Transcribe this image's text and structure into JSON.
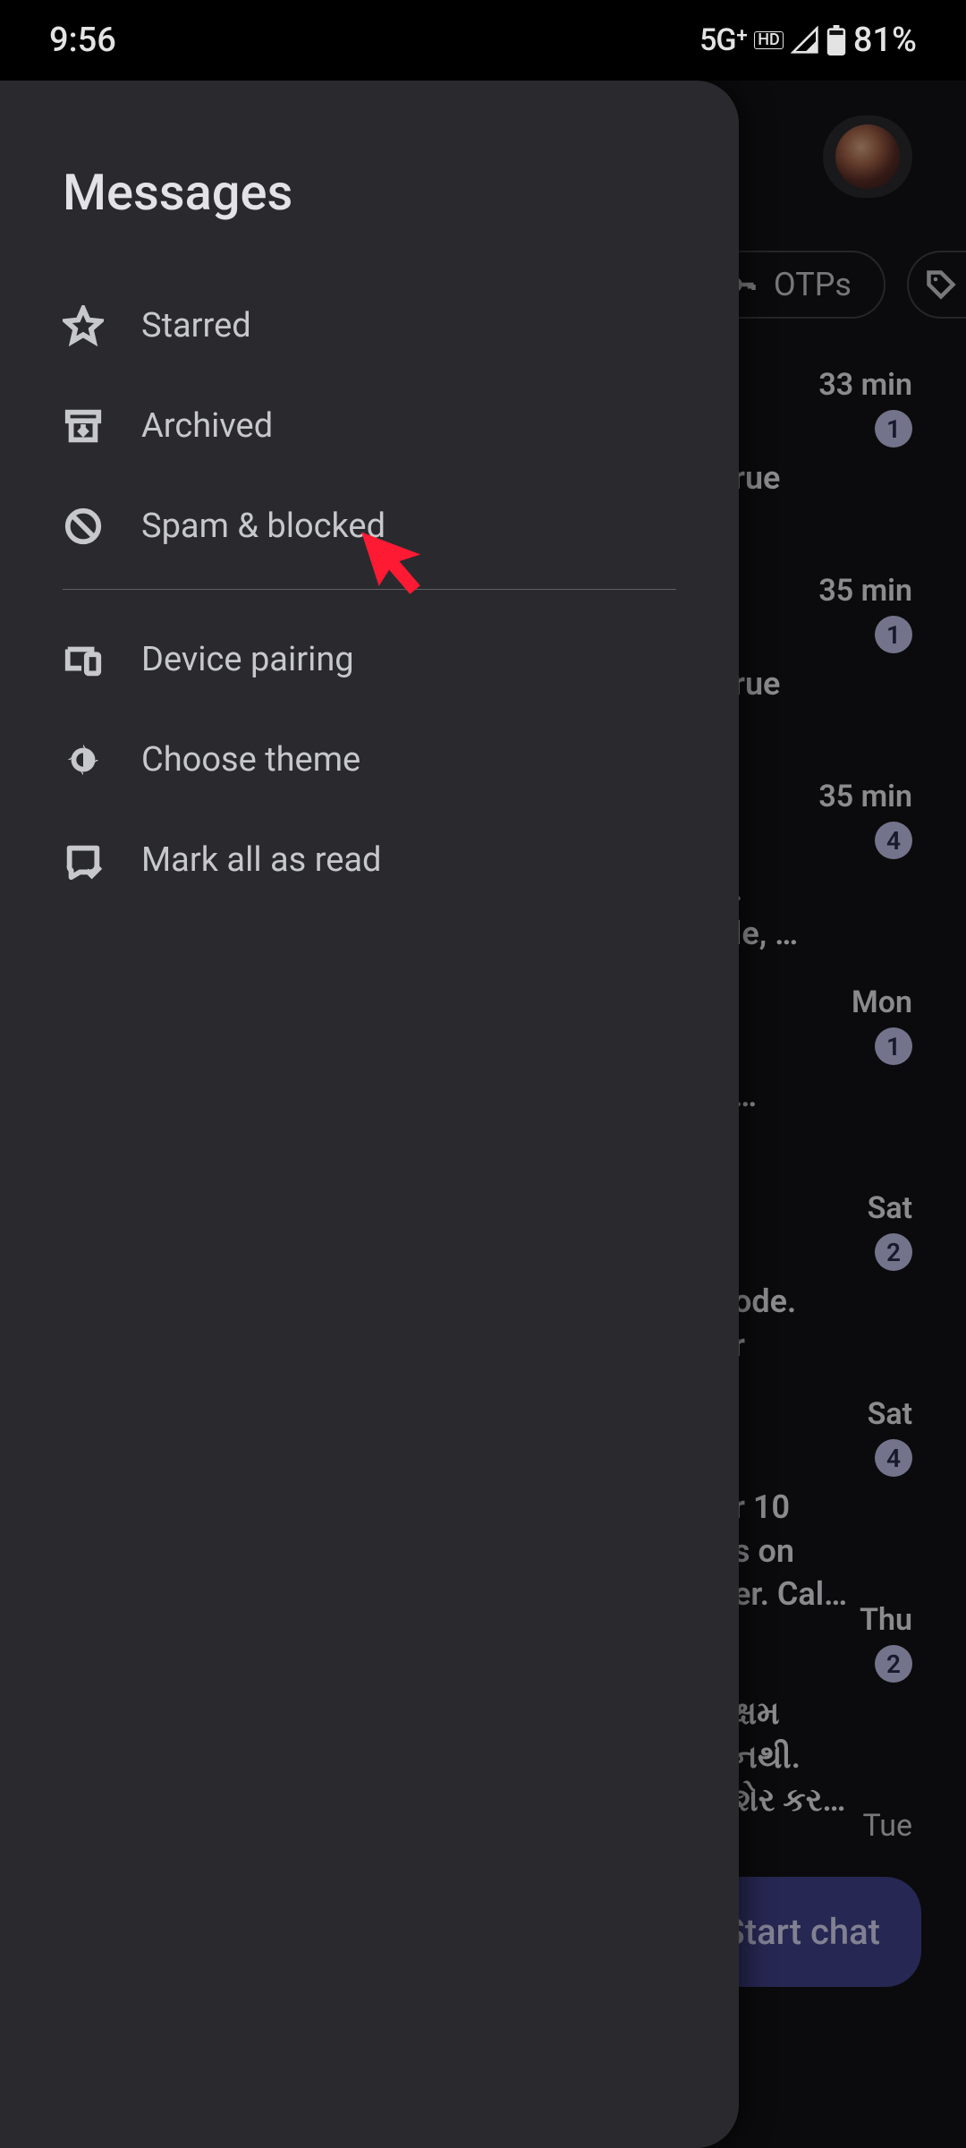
{
  "status": {
    "time": "9:56",
    "network": "5G⁺",
    "battery": "81%"
  },
  "drawer": {
    "title": "Messages",
    "items": [
      {
        "label": "Starred"
      },
      {
        "label": "Archived"
      },
      {
        "label": "Spam & blocked"
      },
      {
        "label": "Device pairing"
      },
      {
        "label": "Choose theme"
      },
      {
        "label": "Mark all as read"
      }
    ]
  },
  "chips": {
    "otps": "OTPs"
  },
  "conversations": [
    {
      "time": "33 min",
      "badge": "1",
      "snippet": "rue"
    },
    {
      "time": "35 min",
      "badge": "1",
      "snippet": "rue"
    },
    {
      "time": "35 min",
      "badge": "4",
      "snippet": ".\nle, …"
    },
    {
      "time": "Mon",
      "badge": "1",
      "snippet": "…"
    },
    {
      "time": "Sat",
      "badge": "2",
      "snippet": "ode.\nr"
    },
    {
      "time": "Sat",
      "badge": "4",
      "snippet": "r 10\ns on\ner. Cal…"
    },
    {
      "time": "Thu",
      "badge": "2",
      "snippet": "ક્ષમ\nનથી.\nશેર કર…"
    },
    {
      "time": "Tue",
      "badge": "",
      "snippet": ""
    }
  ],
  "fab": {
    "label": "Start chat"
  }
}
